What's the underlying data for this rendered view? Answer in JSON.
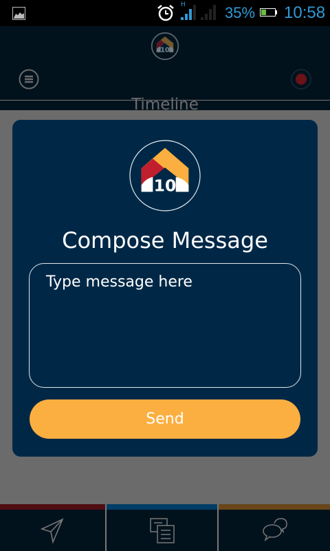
{
  "status_bar": {
    "battery_percent": "35%",
    "time": "10:58",
    "network_type": "H",
    "battery_level": 0.35,
    "signal_color": "#2f9ad6",
    "icons": [
      "image-icon",
      "alarm-icon",
      "signal-icon",
      "signal-icon-sim2",
      "battery-icon"
    ]
  },
  "header": {
    "title": "Timeline",
    "logo_text": "10",
    "icons": [
      "menu-icon",
      "record-icon"
    ]
  },
  "compose": {
    "title": "Compose Message",
    "logo_text": "10",
    "message_value": "",
    "message_placeholder": "Type message here",
    "send_label": "Send"
  },
  "bottom_nav": {
    "tabs": [
      {
        "icon": "send-icon",
        "color": "#4f0d14"
      },
      {
        "icon": "documents-icon",
        "color": "#003d66"
      },
      {
        "icon": "chat-icon",
        "color": "#684619"
      }
    ]
  }
}
